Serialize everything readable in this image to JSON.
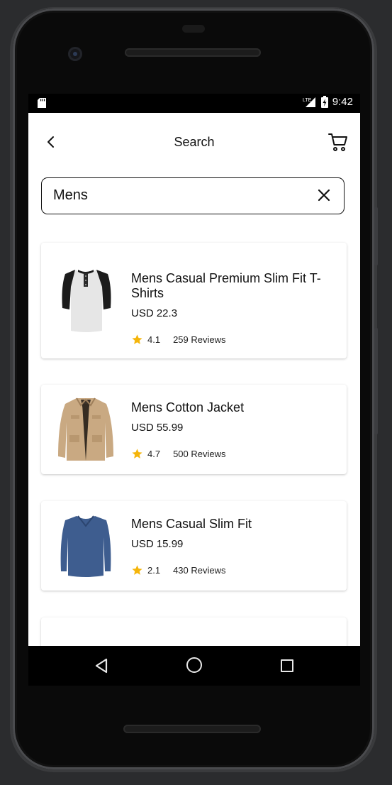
{
  "status_bar": {
    "time": "9:42",
    "network": "LTE"
  },
  "header": {
    "title": "Search",
    "back_icon": "chevron-left-icon",
    "cart_icon": "cart-icon"
  },
  "search": {
    "value": "Mens",
    "clear_icon": "close-icon"
  },
  "products": [
    {
      "name": "Mens Casual Premium Slim Fit T-Shirts",
      "price": "USD 22.3",
      "rating": "4.1",
      "reviews": "259 Reviews",
      "image": "raglan-henley-shirt"
    },
    {
      "name": "Mens Cotton Jacket",
      "price": "USD 55.99",
      "rating": "4.7",
      "reviews": "500 Reviews",
      "image": "khaki-jacket"
    },
    {
      "name": "Mens Casual Slim Fit",
      "price": "USD 15.99",
      "rating": "2.1",
      "reviews": "430 Reviews",
      "image": "navy-long-sleeve-shirt"
    }
  ],
  "colors": {
    "star": "#f5b50a",
    "text": "#111111",
    "screen_bg": "#ffffff",
    "device_bg": "#2b2c2e"
  },
  "nav_bar": {
    "back_icon": "triangle-back-icon",
    "home_icon": "circle-home-icon",
    "recent_icon": "square-recents-icon"
  }
}
